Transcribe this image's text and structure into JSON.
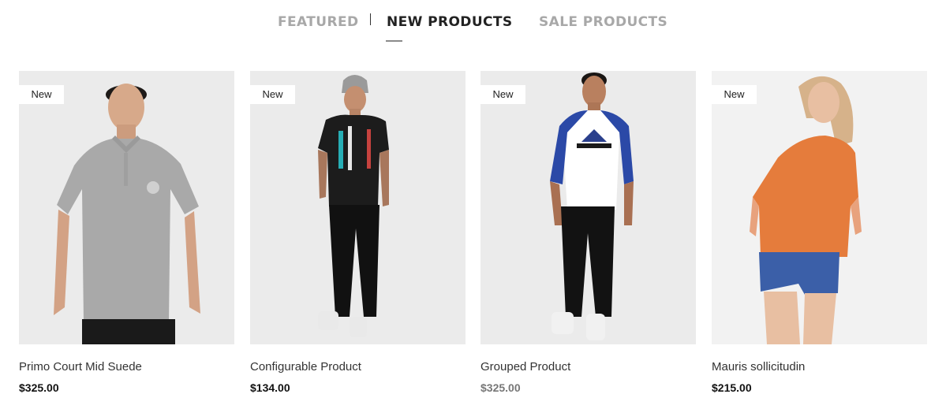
{
  "tabs": {
    "featured": "FEATURED",
    "new": "NEW PRODUCTS",
    "sale": "SALE PRODUCTS"
  },
  "badge_label": "New",
  "products": [
    {
      "name": "Primo Court Mid Suede",
      "price": "$325.00",
      "badge": "New"
    },
    {
      "name": "Configurable Product",
      "price": "$134.00",
      "badge": "New"
    },
    {
      "name": "Grouped Product",
      "price": "$325.00",
      "badge": "New"
    },
    {
      "name": "Mauris sollicitudin",
      "price": "$215.00",
      "badge": "New"
    }
  ],
  "colors": {
    "active_tab": "#222222",
    "inactive_tab": "#a8a8a8",
    "muted_price": "#777777"
  }
}
